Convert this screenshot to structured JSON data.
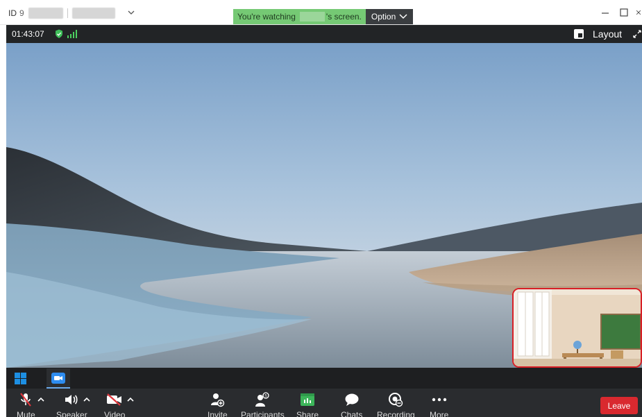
{
  "titlebar": {
    "id_label": "ID",
    "id_value_partial": "9"
  },
  "banner": {
    "watching_prefix": "You're watching",
    "watching_suffix": "'s screen.",
    "option_label": "Option"
  },
  "infobar": {
    "elapsed_time": "01:43:07",
    "layout_label": "Layout"
  },
  "toolbar": {
    "mute_label": "Mute",
    "speaker_label": "Speaker",
    "video_label": "Video",
    "invite_label": "Invite",
    "participants_label": "Participants",
    "share_label": "Share",
    "chats_label": "Chats",
    "recording_label": "Recording",
    "more_label": "More",
    "leave_label": "Leave"
  },
  "colors": {
    "banner_green": "#75c974",
    "leave_red": "#d9292f",
    "selfview_border": "#d81f26",
    "signal_green": "#4cd060"
  },
  "icons": {
    "security": "shield-check-icon",
    "signal": "signal-bars-icon",
    "layout": "layout-icon",
    "fullscreen": "expand-icon",
    "taskbar_start": "windows-logo-icon",
    "taskbar_app": "video-camera-app-icon"
  }
}
